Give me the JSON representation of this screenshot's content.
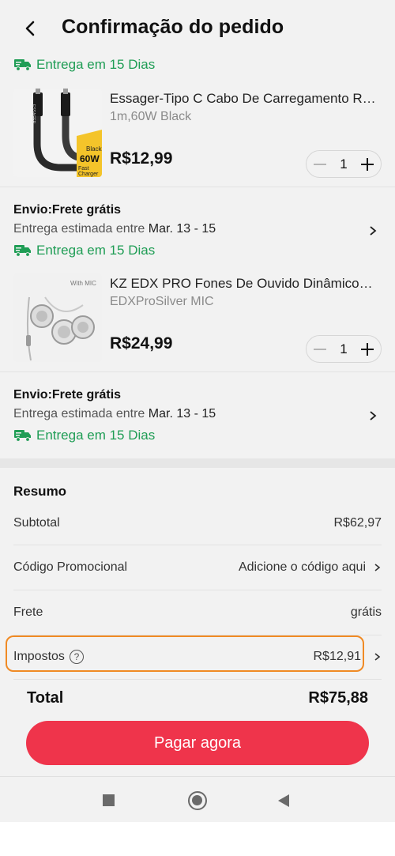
{
  "header": {
    "title": "Confirmação do pedido"
  },
  "top_delivery": {
    "label": "Entrega em 15 Dias"
  },
  "products": [
    {
      "name": "Essager-Tipo C Cabo De Carregamento Rápi",
      "variant": "1m,60W Black",
      "price": "R$12,99",
      "quantity": "1",
      "thumb_label_top": "Black",
      "thumb_label_mid": "60W",
      "thumb_label_bottom": "Fast Charger",
      "thumb_brand": "ESSAGER"
    },
    {
      "name": "KZ EDX PRO Fones De Ouvido Dinâmicos HI...",
      "variant": "EDXProSilver MIC",
      "price": "R$24,99",
      "quantity": "1",
      "thumb_label_top": "With MIC"
    }
  ],
  "shipping": [
    {
      "title": "Envio:Frete grátis",
      "estimate_prefix": "Entrega estimada entre",
      "estimate_dates": "Mar. 13 - 15",
      "delivery": "Entrega em 15 Dias"
    },
    {
      "title": "Envio:Frete grátis",
      "estimate_prefix": "Entrega estimada entre",
      "estimate_dates": "Mar. 13 - 15",
      "delivery": "Entrega em 15 Dias"
    }
  ],
  "summary": {
    "title": "Resumo",
    "subtotal_label": "Subtotal",
    "subtotal_value": "R$62,97",
    "promo_label": "Código Promocional",
    "promo_value": "Adicione o código aqui",
    "shipping_label": "Frete",
    "shipping_value": "grátis",
    "tax_label": "Impostos",
    "tax_help": "?",
    "tax_value": "R$12,91"
  },
  "total": {
    "label": "Total",
    "value": "R$75,88"
  },
  "pay_button": {
    "label": "Pagar agora"
  },
  "colors": {
    "accent": "#ef344b",
    "delivery_green": "#1f9d55",
    "highlight_orange": "#f08a24"
  },
  "icons": [
    "back-arrow-icon",
    "truck-icon",
    "minus-icon",
    "plus-icon",
    "chevron-right-icon",
    "help-circle-icon",
    "nav-recents-icon",
    "nav-home-icon",
    "nav-back-icon"
  ]
}
